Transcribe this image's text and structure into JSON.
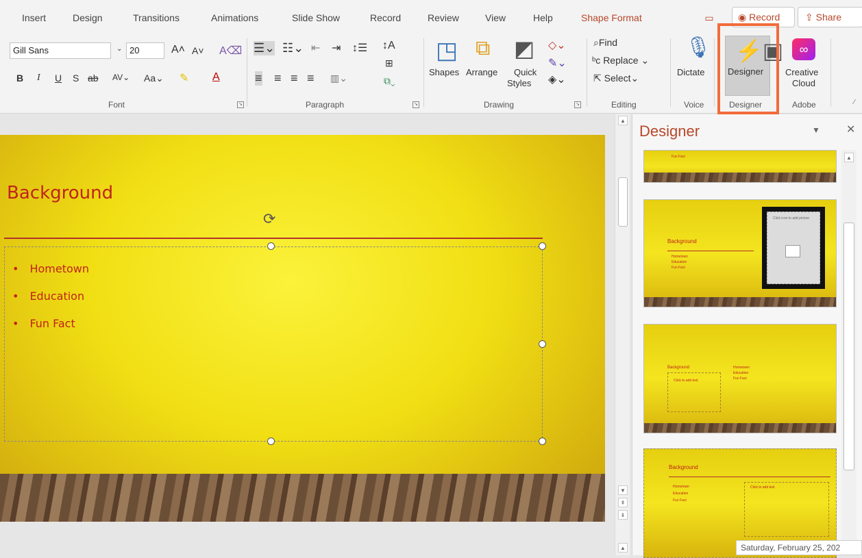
{
  "tabs": [
    "Insert",
    "Design",
    "Transitions",
    "Animations",
    "Slide Show",
    "Record",
    "Review",
    "View",
    "Help",
    "Shape Format"
  ],
  "header": {
    "record_label": "Record",
    "share_label": "Share"
  },
  "ribbon": {
    "font": {
      "name": "Gill Sans",
      "size": "20",
      "group_label": "Font",
      "case_label": "Aa"
    },
    "paragraph": {
      "group_label": "Paragraph"
    },
    "drawing": {
      "shapes": "Shapes",
      "arrange": "Arrange",
      "quick": "Quick",
      "styles": "Styles",
      "group_label": "Drawing"
    },
    "editing": {
      "find": "Find",
      "replace": "Replace",
      "select": "Select",
      "group_label": "Editing"
    },
    "voice": {
      "dictate": "Dictate",
      "group_label": "Voice"
    },
    "designer": {
      "button": "Designer",
      "group_label": "Designer"
    },
    "adobe": {
      "creative": "Creative",
      "cloud": "Cloud",
      "group_label": "Adobe"
    }
  },
  "slide": {
    "title": "Background",
    "bullets": [
      "Hometown",
      "Education",
      "Fun Fact"
    ],
    "background_color": "#f1df14",
    "text_color": "#c0231a"
  },
  "designer_pane": {
    "title": "Designer",
    "thumb_title": "Background",
    "thumb_bullets": [
      "Hometown",
      "Education",
      "Fun Fact"
    ],
    "click_text": "Click to add text",
    "click_picture": "Click icon to add picture",
    "partial_text": "Fun Fact"
  },
  "tooltip": "Saturday, February 25, 202",
  "colors": {
    "accent": "#b7472a",
    "highlight": "#f26b3a"
  }
}
